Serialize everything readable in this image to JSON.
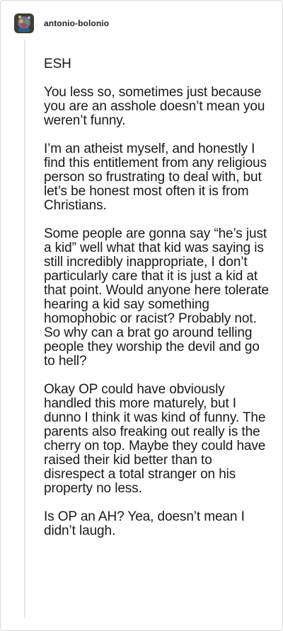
{
  "post": {
    "username": "antonio-bolonio",
    "avatar_icon": "avatar-icon",
    "paragraphs": [
      "ESH",
      "You less so, sometimes just because you are an asshole doesn’t mean you weren’t funny.",
      "I’m an atheist myself, and honestly I find this entitlement from any religious person so frustrating to deal with, but let’s be honest most often it is from Christians.",
      "Some people are gonna say “he’s just a kid” well what that kid was saying is still incredibly inappropriate, I don’t particularly care that it is just a kid at that point. Would anyone here tolerate hearing a kid say something homophobic or racist? Probably not. So why can a brat go around telling people they worship the devil and go to hell?",
      "Okay OP could have obviously handled this more maturely, but I dunno I think it was kind of funny. The parents also freaking out really is the cherry on top. Maybe they could have raised their kid better than to disrespect a total stranger on his property no less.",
      "Is OP an AH? Yea, doesn’t mean I didn’t laugh."
    ]
  }
}
